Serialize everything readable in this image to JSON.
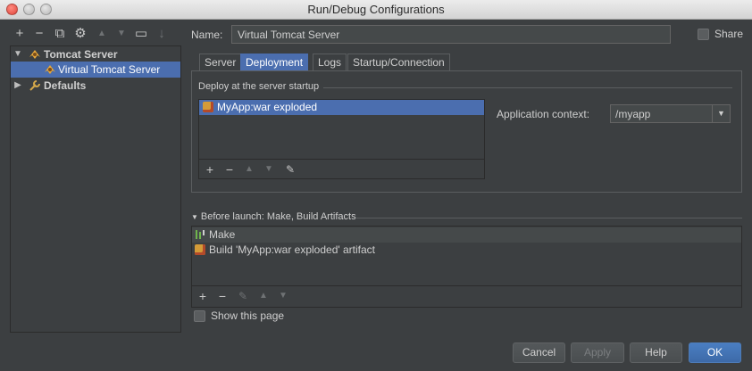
{
  "window": {
    "title": "Run/Debug Configurations"
  },
  "toolbar": {
    "add": "+",
    "remove": "−",
    "copy": "⧉",
    "settings": "⚙",
    "up": "▲",
    "down": "▼",
    "folder": "▭",
    "sort": "↓"
  },
  "tree": {
    "items": [
      {
        "label": "Tomcat Server",
        "icon": "tomcat-icon",
        "expanded": true
      },
      {
        "label": "Virtual Tomcat Server",
        "icon": "tomcat-icon",
        "selected": true
      },
      {
        "label": "Defaults",
        "icon": "wrench-icon",
        "expanded": false
      }
    ]
  },
  "config": {
    "name_label": "Name:",
    "name_value": "Virtual Tomcat Server",
    "share_label": "Share"
  },
  "tabs": [
    {
      "label": "Server"
    },
    {
      "label": "Deployment",
      "active": true
    },
    {
      "label": "Logs"
    },
    {
      "label": "Startup/Connection"
    }
  ],
  "deployment": {
    "section_title": "Deploy at the server startup",
    "items": [
      {
        "label": "MyApp:war exploded",
        "icon": "artifact-icon"
      }
    ],
    "toolbar": {
      "add": "+",
      "remove": "−",
      "up": "▲",
      "down": "▼",
      "edit": "✎"
    },
    "context_label": "Application context:",
    "context_value": "/myapp"
  },
  "before_launch": {
    "section_title": "Before launch: Make, Build Artifacts",
    "items": [
      {
        "label": "Make",
        "icon": "make-icon"
      },
      {
        "label": "Build 'MyApp:war exploded' artifact",
        "icon": "artifact-icon"
      }
    ],
    "toolbar": {
      "add": "+",
      "remove": "−",
      "edit": "✎",
      "up": "▲",
      "down": "▼"
    },
    "show_page_label": "Show this page"
  },
  "buttons": {
    "cancel": "Cancel",
    "apply": "Apply",
    "help": "Help",
    "ok": "OK"
  },
  "colors": {
    "background": "#3c3f41",
    "selection": "#4b6eaf",
    "primary_button": "#3d6aa8"
  }
}
